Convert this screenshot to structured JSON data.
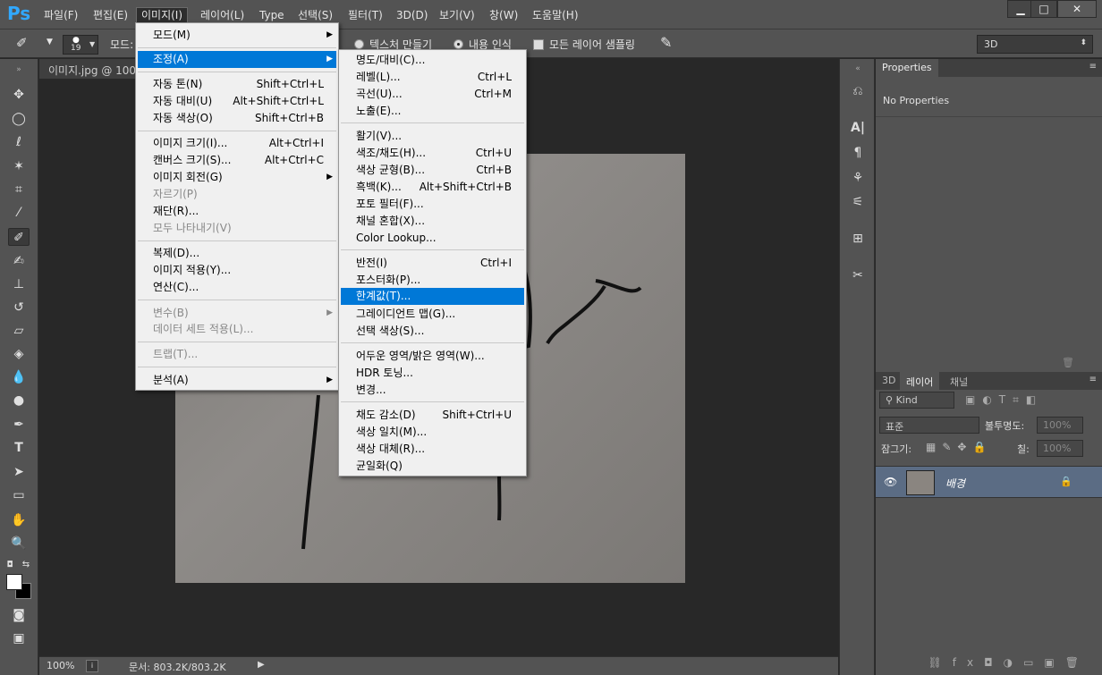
{
  "app": {
    "logo": "Ps"
  },
  "menubar": {
    "items": [
      {
        "label": "파일(F)"
      },
      {
        "label": "편집(E)"
      },
      {
        "label": "이미지(I)"
      },
      {
        "label": "레이어(L)"
      },
      {
        "label": "Type"
      },
      {
        "label": "선택(S)"
      },
      {
        "label": "필터(T)"
      },
      {
        "label": "3D(D)"
      },
      {
        "label": "보기(V)"
      },
      {
        "label": "창(W)"
      },
      {
        "label": "도움말(H)"
      }
    ],
    "active": "이미지(I)"
  },
  "options_bar": {
    "brush_size": "19",
    "mode_label": "모드:",
    "texture_label": "텍스처 만들기",
    "content_aware_label": "내용 인식",
    "sample_all_label": "모든 레이어 샘플링",
    "workspace": "3D"
  },
  "document": {
    "tab_title": "이미지.jpg @ 100%",
    "zoom": "100%",
    "doc_size": "문서: 803.2K/803.2K"
  },
  "image_menu": {
    "items": [
      {
        "label": "모드(M)",
        "shortcut": "",
        "submenu": true
      },
      {
        "label": "조정(A)",
        "shortcut": "",
        "submenu": true,
        "highlight": true
      },
      {
        "label": "자동 톤(N)",
        "shortcut": "Shift+Ctrl+L"
      },
      {
        "label": "자동 대비(U)",
        "shortcut": "Alt+Shift+Ctrl+L"
      },
      {
        "label": "자동 색상(O)",
        "shortcut": "Shift+Ctrl+B"
      },
      {
        "label": "이미지 크기(I)...",
        "shortcut": "Alt+Ctrl+I"
      },
      {
        "label": "캔버스 크기(S)...",
        "shortcut": "Alt+Ctrl+C"
      },
      {
        "label": "이미지 회전(G)",
        "shortcut": "",
        "submenu": true
      },
      {
        "label": "자르기(P)",
        "shortcut": "",
        "disabled": true
      },
      {
        "label": "재단(R)...",
        "shortcut": ""
      },
      {
        "label": "모두 나타내기(V)",
        "shortcut": "",
        "disabled": true
      },
      {
        "label": "복제(D)...",
        "shortcut": ""
      },
      {
        "label": "이미지 적용(Y)...",
        "shortcut": ""
      },
      {
        "label": "연산(C)...",
        "shortcut": ""
      },
      {
        "label": "변수(B)",
        "shortcut": "",
        "submenu": true,
        "disabled": true
      },
      {
        "label": "데이터 세트 적용(L)...",
        "shortcut": "",
        "disabled": true
      },
      {
        "label": "트랩(T)...",
        "shortcut": "",
        "disabled": true
      },
      {
        "label": "분석(A)",
        "shortcut": "",
        "submenu": true
      }
    ]
  },
  "adjust_menu": {
    "items": [
      {
        "label": "명도/대비(C)...",
        "shortcut": ""
      },
      {
        "label": "레벨(L)...",
        "shortcut": "Ctrl+L"
      },
      {
        "label": "곡선(U)...",
        "shortcut": "Ctrl+M"
      },
      {
        "label": "노출(E)...",
        "shortcut": ""
      },
      {
        "label": "활기(V)...",
        "shortcut": ""
      },
      {
        "label": "색조/채도(H)...",
        "shortcut": "Ctrl+U"
      },
      {
        "label": "색상 균형(B)...",
        "shortcut": "Ctrl+B"
      },
      {
        "label": "흑백(K)...",
        "shortcut": "Alt+Shift+Ctrl+B"
      },
      {
        "label": "포토 필터(F)...",
        "shortcut": ""
      },
      {
        "label": "채널 혼합(X)...",
        "shortcut": ""
      },
      {
        "label": "Color Lookup...",
        "shortcut": ""
      },
      {
        "label": "반전(I)",
        "shortcut": "Ctrl+I"
      },
      {
        "label": "포스터화(P)...",
        "shortcut": ""
      },
      {
        "label": "한계값(T)...",
        "shortcut": "",
        "highlight": true
      },
      {
        "label": "그레이디언트 맵(G)...",
        "shortcut": ""
      },
      {
        "label": "선택 색상(S)...",
        "shortcut": ""
      },
      {
        "label": "어두운 영역/밝은 영역(W)...",
        "shortcut": ""
      },
      {
        "label": "HDR 토닝...",
        "shortcut": ""
      },
      {
        "label": "변경...",
        "shortcut": ""
      },
      {
        "label": "채도 감소(D)",
        "shortcut": "Shift+Ctrl+U"
      },
      {
        "label": "색상 일치(M)...",
        "shortcut": ""
      },
      {
        "label": "색상 대체(R)...",
        "shortcut": ""
      },
      {
        "label": "균일화(Q)",
        "shortcut": ""
      }
    ]
  },
  "properties_panel": {
    "tab": "Properties",
    "content": "No Properties"
  },
  "layers_panel": {
    "tabs": [
      "3D",
      "레이어",
      "채널"
    ],
    "active_tab": "레이어",
    "filter_kind": "Kind",
    "blend_mode": "표준",
    "opacity_label": "불투명도:",
    "opacity_value": "100%",
    "lock_label": "잠그기:",
    "fill_label": "칠:",
    "fill_value": "100%",
    "layers": [
      {
        "name": "배경",
        "visible": true,
        "locked": true
      }
    ]
  }
}
